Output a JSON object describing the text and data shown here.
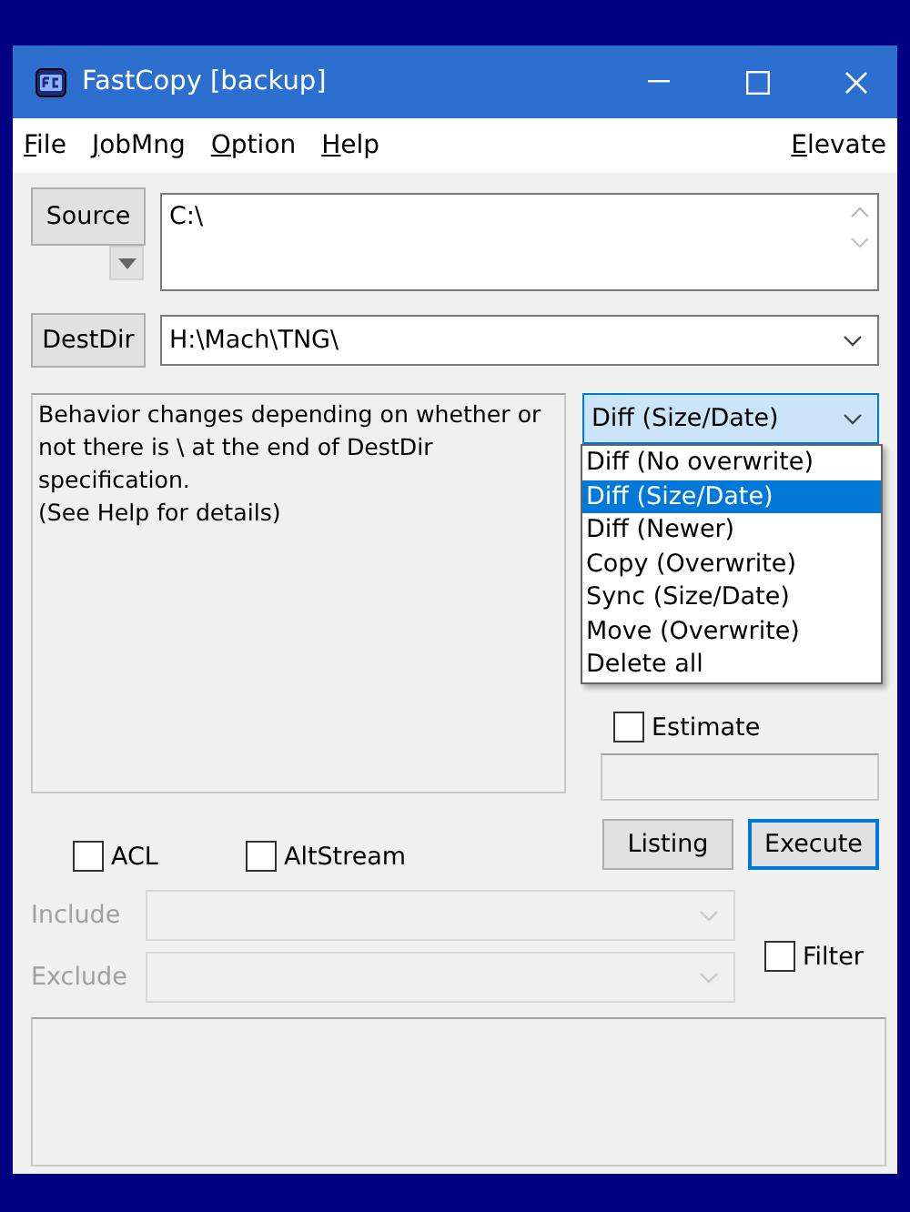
{
  "window": {
    "title": "FastCopy [backup]"
  },
  "menu": [
    {
      "label": "File"
    },
    {
      "label": "JobMng"
    },
    {
      "label": "Option"
    },
    {
      "label": "Help"
    }
  ],
  "menu_right": [
    {
      "label": "Elevate"
    }
  ],
  "source": {
    "button": "Source",
    "value": "C:\\"
  },
  "dest": {
    "button": "DestDir",
    "value": "H:\\Mach\\TNG\\"
  },
  "description": "Behavior changes depending on whether or not there is \\ at the end of DestDir specification.\n(See Help for details)",
  "mode": {
    "value": "Diff (Size/Date)",
    "expanded": true,
    "options": [
      {
        "label": "Diff (No overwrite)",
        "selected": false
      },
      {
        "label": "Diff (Size/Date)",
        "selected": true
      },
      {
        "label": "Diff (Newer)",
        "selected": false
      },
      {
        "label": "Copy (Overwrite)",
        "selected": false
      },
      {
        "label": "Sync (Size/Date)",
        "selected": false
      },
      {
        "label": "Move (Overwrite)",
        "selected": false
      },
      {
        "label": "Delete all",
        "selected": false
      }
    ]
  },
  "estimate": {
    "label": "Estimate",
    "checked": false
  },
  "attributes": [
    {
      "label": "ACL",
      "checked": false
    },
    {
      "label": "AltStream",
      "checked": false
    }
  ],
  "buttons": [
    {
      "label": "Listing",
      "default": false
    },
    {
      "label": "Execute",
      "default": true
    }
  ],
  "filters": [
    {
      "label": "Include",
      "disabled": true
    },
    {
      "label": "Exclude",
      "disabled": true
    }
  ],
  "filter": {
    "label": "Filter",
    "checked": false
  }
}
